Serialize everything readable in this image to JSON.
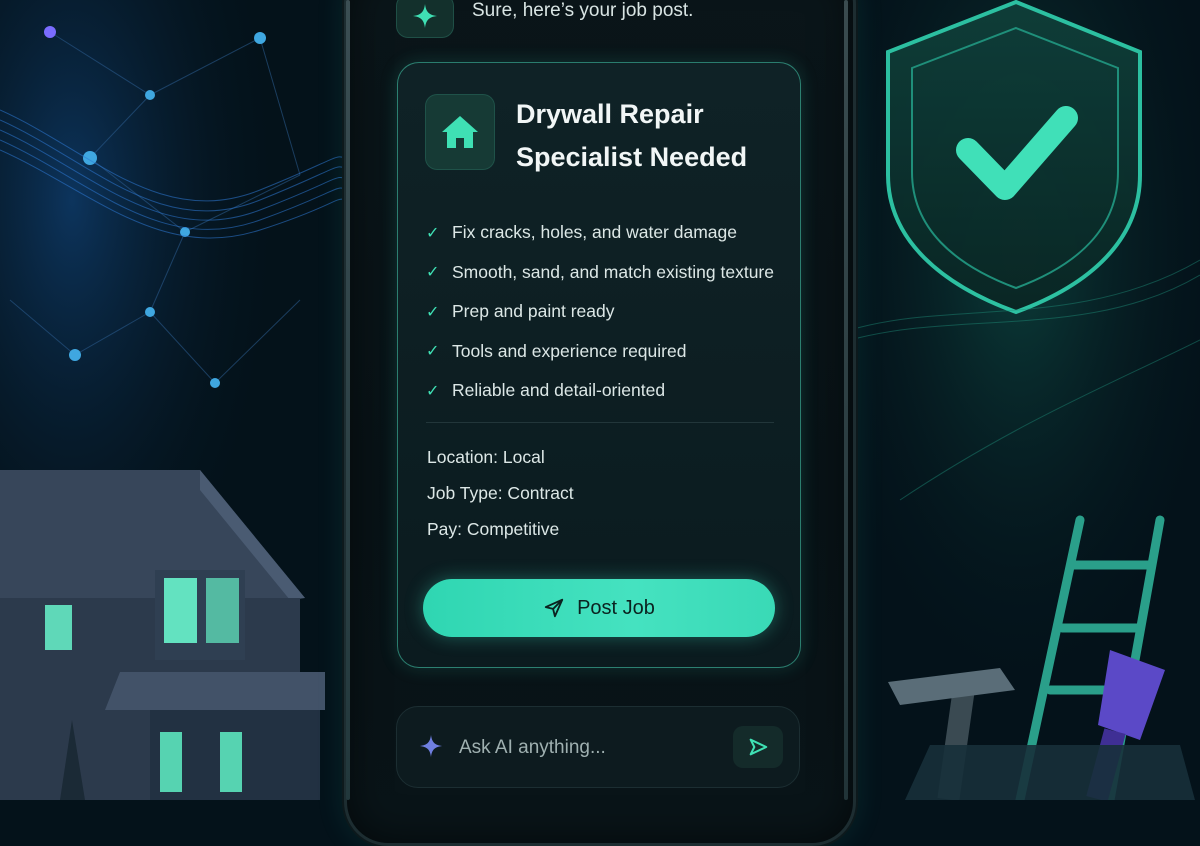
{
  "chat": {
    "assistant_message": "Sure, here’s your job post."
  },
  "job_post": {
    "title": "Drywall Repair\nSpecialist Needed",
    "icon": "house-icon",
    "requirements": [
      "Fix cracks, holes, and water damage",
      "Smooth, sand, and match existing texture",
      "Prep and paint ready",
      "Tools and experience required",
      "Reliable and detail-oriented"
    ],
    "details": {
      "location": "Location: Local",
      "job_type": "Job Type: Contract",
      "pay": "Pay: Competitive"
    },
    "post_button_label": "Post Job"
  },
  "ask_bar": {
    "placeholder": "Ask AI anything..."
  },
  "colors": {
    "accent": "#3fe0b4",
    "background": "#04121a",
    "card": "#0f2226"
  }
}
